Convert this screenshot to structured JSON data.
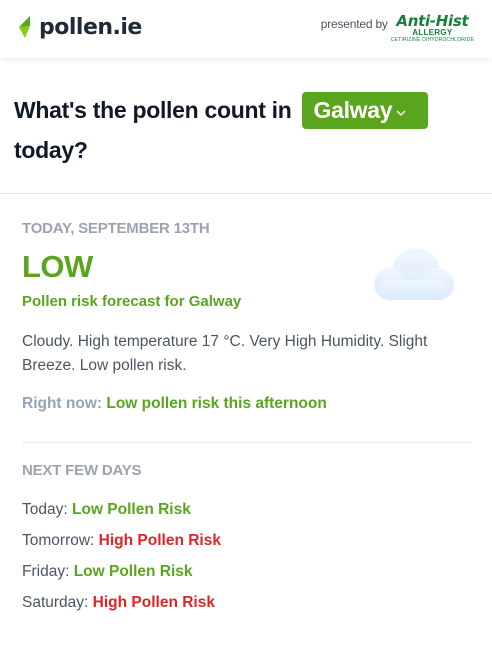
{
  "header": {
    "logo_text": "pollen.ie",
    "presented_by": "presented by",
    "brand_name": "Anti-Hist",
    "brand_sub": "ALLERGY",
    "brand_tag": "CETIRIZINE DIHYDROCHLORIDE"
  },
  "question": {
    "prefix": "What's the pollen count in",
    "location": "Galway",
    "suffix": "today?"
  },
  "forecast": {
    "date": "TODAY, SEPTEMBER 13TH",
    "level": "LOW",
    "subtitle": "Pollen risk forecast for Galway",
    "description": "Cloudy. High temperature 17 °C. Very High Humidity. Slight Breeze. Low pollen risk.",
    "right_now_label": "Right now:",
    "right_now_value": "Low pollen risk this afternoon",
    "weather_icon": "cloud-icon"
  },
  "next_days": {
    "title": "NEXT FEW DAYS",
    "days": [
      {
        "day": "Today:",
        "risk": "Low Pollen Risk"
      },
      {
        "day": "Tomorrow:",
        "risk": "High Pollen Risk"
      },
      {
        "day": "Friday:",
        "risk": "Low Pollen Risk"
      },
      {
        "day": "Saturday:",
        "risk": "High Pollen Risk"
      }
    ]
  },
  "colors": {
    "accent_green": "#5aa51e",
    "risk_high": "#dc2626",
    "brand_green": "#15803d",
    "muted": "#9ca3af"
  }
}
